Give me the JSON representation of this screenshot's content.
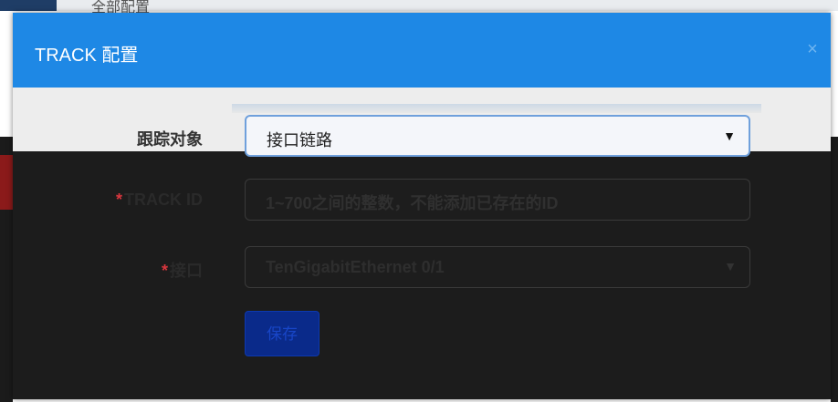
{
  "background": {
    "nav_text": "全部配置"
  },
  "modal": {
    "title": "TRACK 配置",
    "close_glyph": "×"
  },
  "form": {
    "track_object": {
      "label": "跟踪对象",
      "value": "接口链路"
    },
    "track_id": {
      "required_mark": "*",
      "label": "TRACK ID",
      "placeholder": "1~700之间的整数，不能添加已存在的ID",
      "value": ""
    },
    "interface": {
      "required_mark": "*",
      "label": "接口",
      "value": "TenGigabitEthernet 0/1"
    },
    "save_label": "保存"
  },
  "colors": {
    "header_blue": "#1e88e5",
    "required_red": "#d9363e",
    "save_button": "#0a2a8a"
  },
  "icons": {
    "select_arrow": "▼",
    "close": "close-icon"
  }
}
